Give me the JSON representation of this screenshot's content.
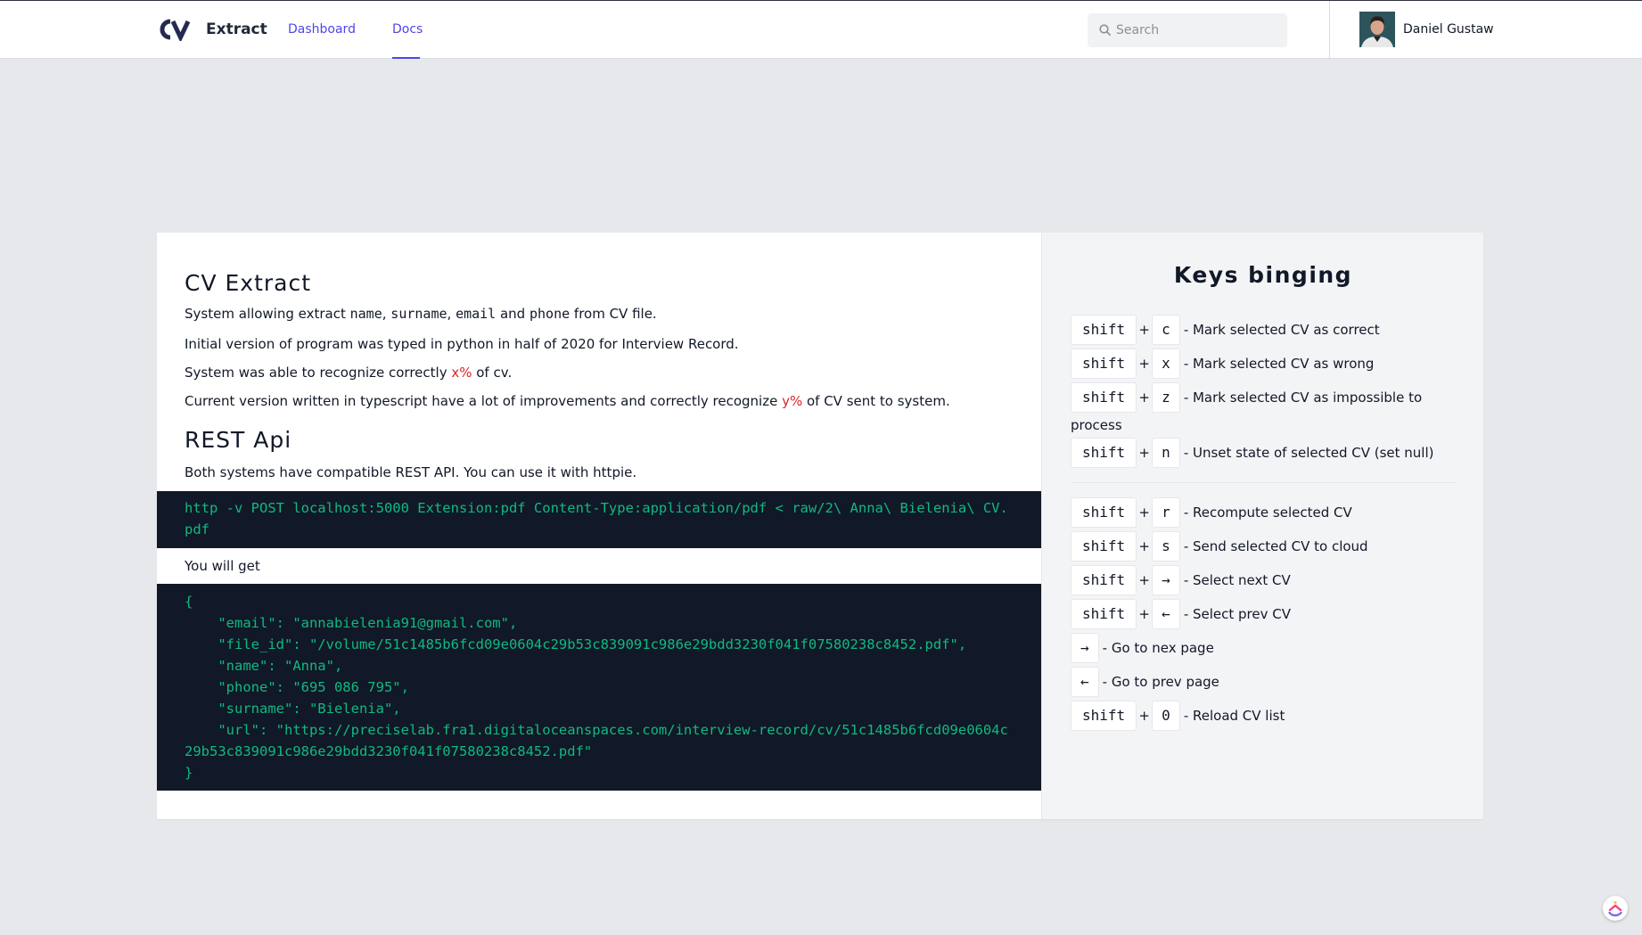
{
  "header": {
    "logo_text": "CV",
    "brand": "Extract",
    "nav": {
      "dashboard": "Dashboard",
      "docs": "Docs"
    },
    "search_placeholder": "Search",
    "user_name": "Daniel Gustaw"
  },
  "doc": {
    "title": "CV Extract",
    "intro": {
      "prefix": "System allowing extract ",
      "f1": "name",
      "s1": ", ",
      "f2": "surname",
      "s2": ", ",
      "f3": "email",
      "s3": " and ",
      "f4": "phone",
      "suffix": " from CV file."
    },
    "initial": "Initial version of program was typed in python in half of 2020 for Interview Record.",
    "recognize": {
      "prefix": "System was able to recognize correctly ",
      "value": "x%",
      "suffix": " of cv."
    },
    "current": {
      "prefix": "Current version written in typescript have a lot of improvements and correctly recognize ",
      "value": "y%",
      "suffix": " of CV sent to system."
    },
    "rest_title": "REST Api",
    "rest_text": "Both systems have compatible REST API. You can use it with httpie.",
    "command": "http -v POST localhost:5000 Extension:pdf Content-Type:application/pdf < raw/2\\ Anna\\ Bielenia\\ CV.pdf",
    "you_will_get": "You will get",
    "response": "{\n    \"email\": \"annabielenia91@gmail.com\",\n    \"file_id\": \"/volume/51c1485b6fcd09e0604c29b53c839091c986e29bdd3230f041f07580238c8452.pdf\",\n    \"name\": \"Anna\",\n    \"phone\": \"695 086 795\",\n    \"surname\": \"Bielenia\",\n    \"url\": \"https://preciselab.fra1.digitaloceanspaces.com/interview-record/cv/51c1485b6fcd09e0604c29b53c839091c986e29bdd3230f041f07580238c8452.pdf\"\n}"
  },
  "keys": {
    "title": "Keys binging",
    "group1": [
      {
        "mod": "shift",
        "key": "c",
        "desc": "- Mark selected CV as correct"
      },
      {
        "mod": "shift",
        "key": "x",
        "desc": "- Mark selected CV as wrong"
      },
      {
        "mod": "shift",
        "key": "z",
        "desc": "- Mark selected CV as impossible to process"
      },
      {
        "mod": "shift",
        "key": "n",
        "desc": "- Unset state of selected CV (set null)"
      }
    ],
    "group2": [
      {
        "mod": "shift",
        "key": "r",
        "desc": "- Recompute selected CV"
      },
      {
        "mod": "shift",
        "key": "s",
        "desc": "- Send selected CV to cloud"
      },
      {
        "mod": "shift",
        "key": "→",
        "desc": "- Select next CV"
      },
      {
        "mod": "shift",
        "key": "←",
        "desc": "- Select prev CV"
      },
      {
        "mod": "",
        "key": "→",
        "desc": "- Go to nex page"
      },
      {
        "mod": "",
        "key": "←",
        "desc": "- Go to prev page"
      },
      {
        "mod": "shift",
        "key": "0",
        "desc": "- Reload CV list"
      }
    ],
    "plus": "+"
  },
  "colors": {
    "accent": "#4f46e5",
    "code_bg": "#111827",
    "code_text": "#10b981",
    "highlight": "#dc2626"
  }
}
